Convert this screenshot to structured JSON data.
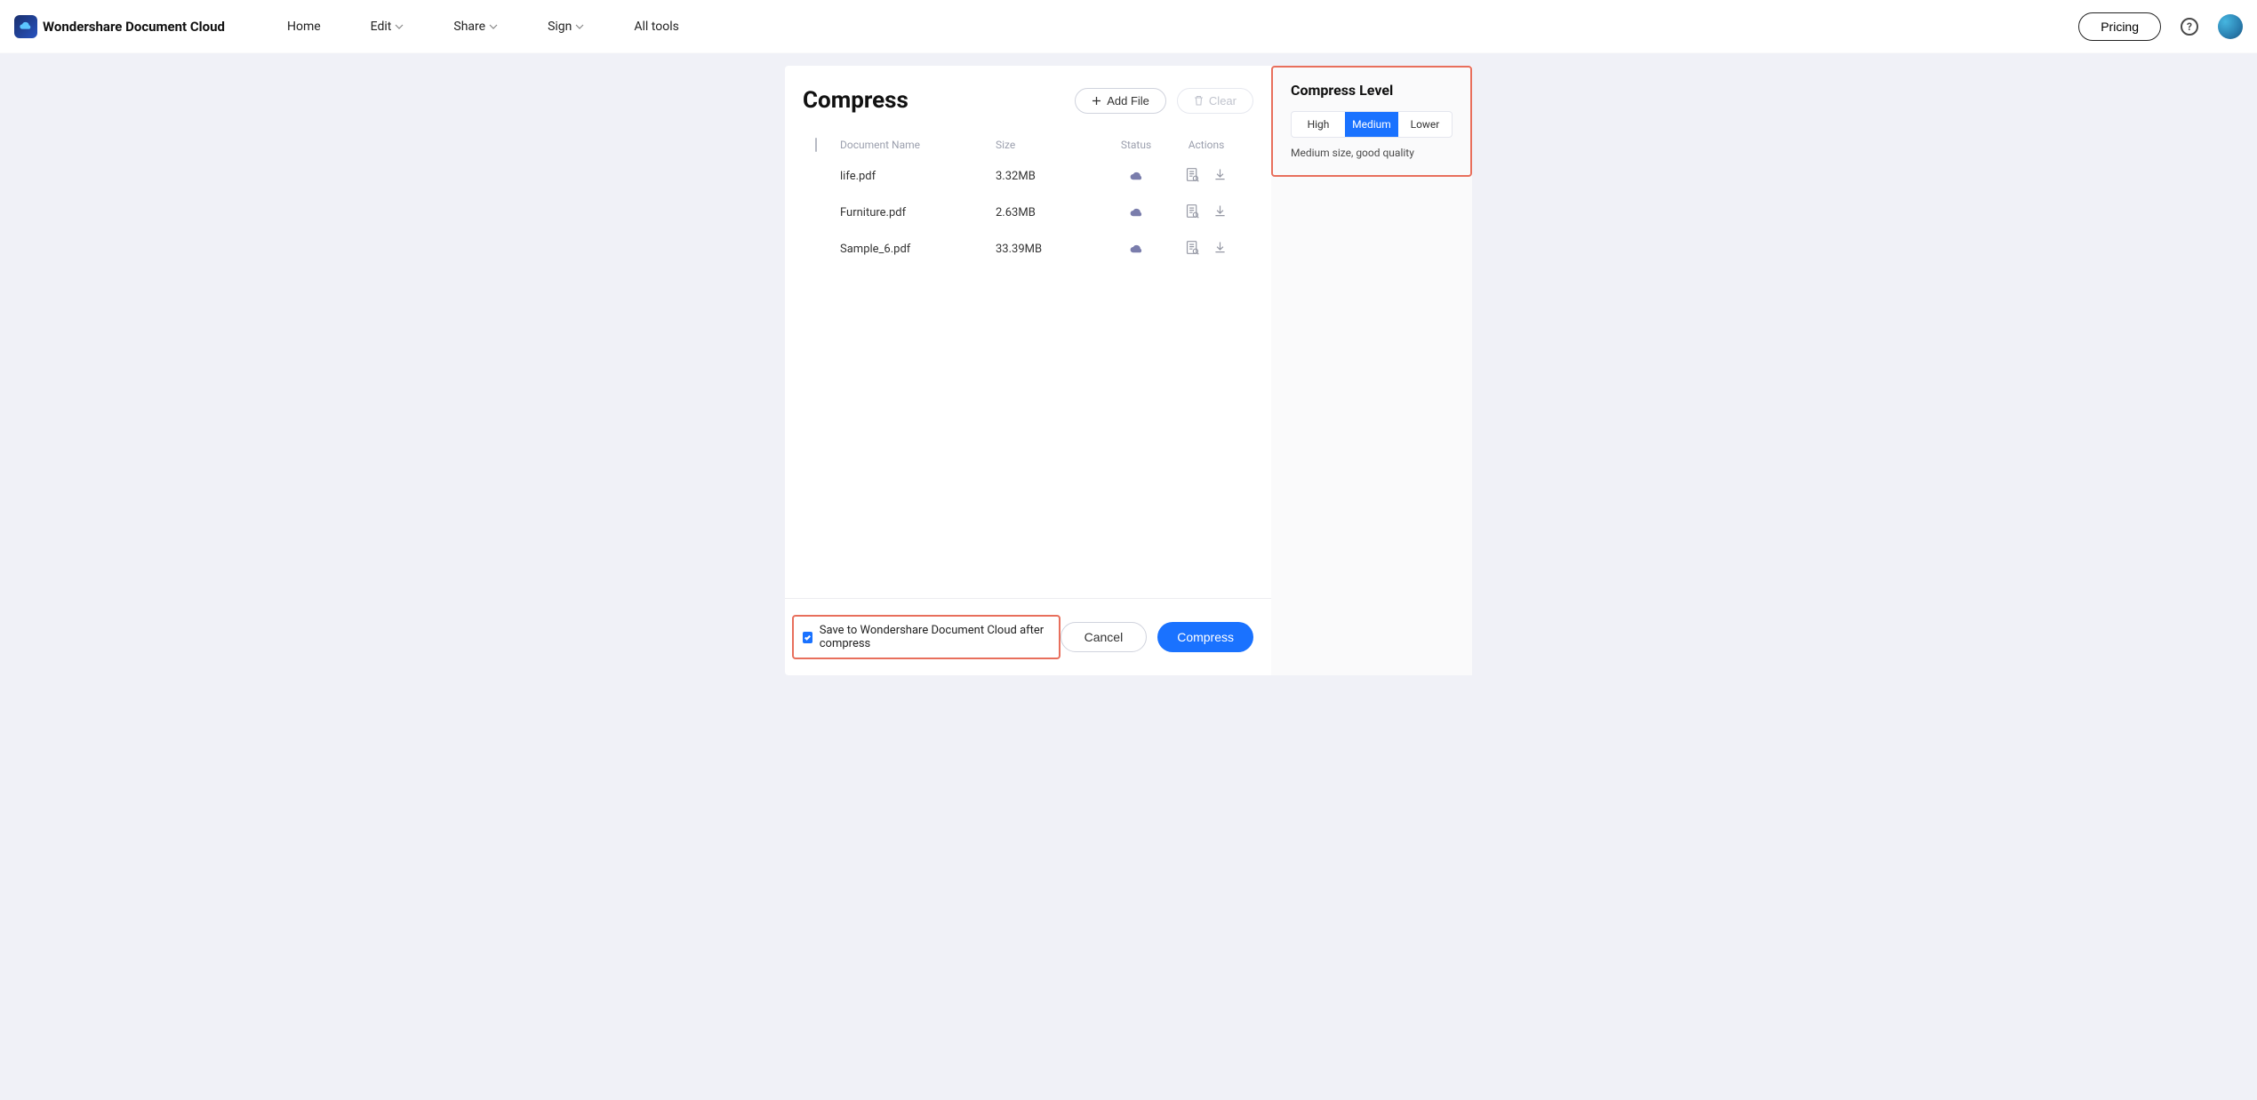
{
  "brand": "Wondershare Document Cloud",
  "nav": {
    "home": "Home",
    "edit": "Edit",
    "share": "Share",
    "sign": "Sign",
    "all_tools": "All tools"
  },
  "header": {
    "pricing": "Pricing"
  },
  "page": {
    "title": "Compress",
    "add_file": "Add File",
    "clear": "Clear"
  },
  "table": {
    "headers": {
      "name": "Document Name",
      "size": "Size",
      "status": "Status",
      "actions": "Actions"
    },
    "rows": [
      {
        "name": "life.pdf",
        "size": "3.32MB"
      },
      {
        "name": "Furniture.pdf",
        "size": "2.63MB"
      },
      {
        "name": "Sample_6.pdf",
        "size": "33.39MB"
      }
    ]
  },
  "side": {
    "title": "Compress Level",
    "options": {
      "high": "High",
      "medium": "Medium",
      "lower": "Lower"
    },
    "desc": "Medium size, good quality"
  },
  "footer": {
    "save_label": "Save to Wondershare Document Cloud after compress",
    "cancel": "Cancel",
    "compress": "Compress"
  }
}
